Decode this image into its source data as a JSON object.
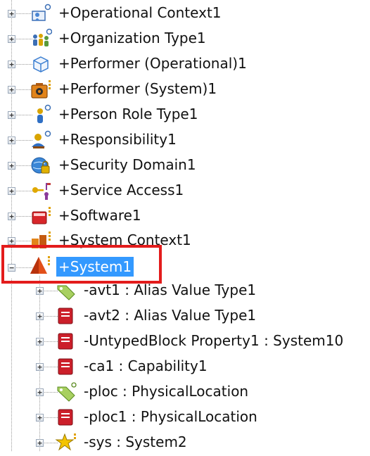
{
  "tree": {
    "items": [
      {
        "label": "+Operational Context1",
        "icon": "operational-context-icon"
      },
      {
        "label": "+Organization Type1",
        "icon": "organization-type-icon"
      },
      {
        "label": "+Performer (Operational)1",
        "icon": "performer-operational-icon"
      },
      {
        "label": "+Performer (System)1",
        "icon": "performer-system-icon"
      },
      {
        "label": "+Person Role Type1",
        "icon": "person-role-type-icon"
      },
      {
        "label": "+Responsibility1",
        "icon": "responsibility-icon"
      },
      {
        "label": "+Security Domain1",
        "icon": "security-domain-icon"
      },
      {
        "label": "+Service Access1",
        "icon": "service-access-icon"
      },
      {
        "label": "+Software1",
        "icon": "software-icon"
      },
      {
        "label": "+System Context1",
        "icon": "system-context-icon"
      },
      {
        "label": "+System1",
        "icon": "system-icon",
        "selected": true,
        "expanded": true
      },
      {
        "label": "-avt1 : Alias Value Type1",
        "icon": "value-type-icon",
        "child": true
      },
      {
        "label": "-avt2 : Alias Value Type1",
        "icon": "block-property-icon",
        "child": true
      },
      {
        "label": "-UntypedBlock Property1 : System10",
        "icon": "block-property-icon",
        "child": true
      },
      {
        "label": "-ca1 : Capability1",
        "icon": "block-property-icon",
        "child": true
      },
      {
        "label": "-ploc : PhysicalLocation",
        "icon": "value-type-icon",
        "child": true
      },
      {
        "label": "-ploc1 : PhysicalLocation",
        "icon": "block-property-icon",
        "child": true
      },
      {
        "label": "-sys : System2",
        "icon": "star-icon",
        "child": true
      }
    ]
  },
  "colors": {
    "selection": "#3399ff",
    "highlight_box": "#e31c1c"
  }
}
